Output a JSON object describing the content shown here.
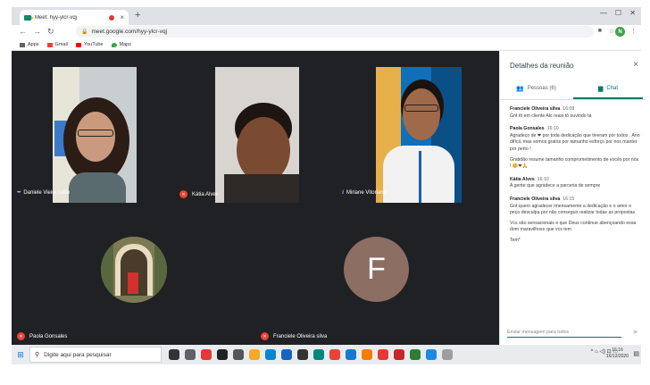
{
  "browser": {
    "tab_title": "Meet: hyy-ylcr-vqj",
    "tab_close": "×",
    "new_tab": "+",
    "url": "meet.google.com/hyy-ylcr-vqj",
    "profile_initial": "N",
    "window_controls": [
      "—",
      "☐",
      "✕"
    ],
    "bookmarks": [
      {
        "label": "Apps",
        "color": "#5f6368"
      },
      {
        "label": "Gmail",
        "color": "#ea4335"
      },
      {
        "label": "YouTube",
        "color": "#ff0000"
      },
      {
        "label": "Maps",
        "color": "#34a853"
      }
    ]
  },
  "meet": {
    "participants": [
      {
        "name": "Daniele Vieira Leite",
        "mic": "speaking"
      },
      {
        "name": "Kátia Alves",
        "mic": "muted"
      },
      {
        "name": "Miriane Vitoriano",
        "mic": "speaking"
      },
      {
        "name": "Paola Gonsales",
        "mic": "muted"
      },
      {
        "name": "Franciele Oliveira silva",
        "mic": "muted",
        "avatar_letter": "F"
      }
    ]
  },
  "panel": {
    "title": "Detalhes da reunião",
    "close": "×",
    "tab_people": "Pessoas (6)",
    "tab_chat": "Chat",
    "accent": "#00796b",
    "messages": [
      {
        "sender": "Franciele Oliveira silva",
        "time": "16:09",
        "lines": [
          "Gnt tô em cliente Aki reais tô ouvindo tá"
        ]
      },
      {
        "sender": "Paola Gonsales",
        "time": "16:10",
        "lines": [
          "Agradeço de ❤ por toda dedicação que tiveram por todos . Ano difícil, mas somos gratos por tamanho esforço por nos manter por perto !",
          "Gratidão resume tamanho comprometimento de vocês por nós ! 😊❤🙏"
        ]
      },
      {
        "sender": "Kátia Alves",
        "time": "16:10",
        "lines": [
          "A gente que agradece a parceria de sempre"
        ]
      },
      {
        "sender": "Franciele Oliveira silva",
        "time": "16:15",
        "lines": [
          "Gnt quero agradecer imensamente a dedicação e o amor e peço desculpa por não conseguir realizar todas as propostas",
          "Vcs são sensacionais e que Deus continue abençoando essa dom maravilhoso que vcs tem",
          "Tem*"
        ]
      }
    ],
    "input_placeholder": "Enviar mensagem para todos"
  },
  "taskbar": {
    "search_placeholder": "Digite aqui para pesquisar",
    "time": "16:16",
    "date": "16/12/2020",
    "app_colors": [
      "#333333",
      "#5f6368",
      "#e53935",
      "#222222",
      "#555555",
      "#f9a825",
      "#0288d1",
      "#1565c0",
      "#333333",
      "#00897b",
      "#ea4335",
      "#1976d2",
      "#f57c00",
      "#e53935",
      "#c62828",
      "#2e7d32",
      "#1e88e5",
      "#9e9e9e"
    ]
  }
}
